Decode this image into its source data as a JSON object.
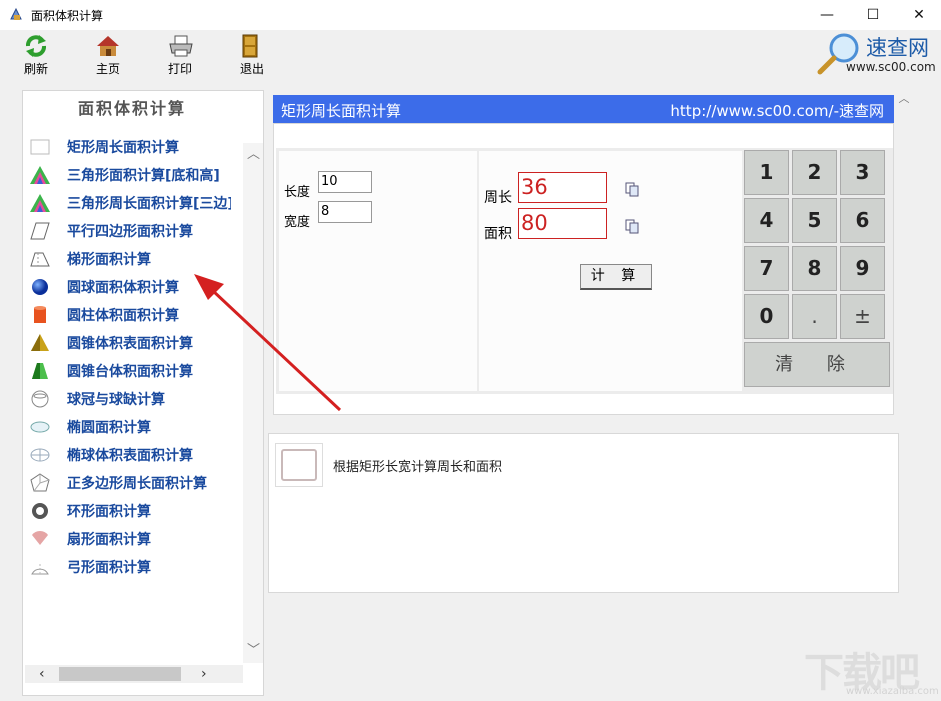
{
  "window": {
    "title": "面积体积计算",
    "controls": {
      "minimize": "—",
      "maximize": "☐",
      "close": "✕"
    }
  },
  "toolbar": {
    "refresh_label": "刷新",
    "home_label": "主页",
    "print_label": "打印",
    "exit_label": "退出"
  },
  "logo": {
    "name": "速查网",
    "url": "www.sc00.com"
  },
  "sidebar": {
    "title": "面积体积计算",
    "items": [
      {
        "label": "矩形周长面积计算",
        "icon": "rectangle-icon"
      },
      {
        "label": "三角形面积计算[底和高]",
        "icon": "triangle-icon"
      },
      {
        "label": "三角形周长面积计算[三边]",
        "icon": "triangle-icon"
      },
      {
        "label": "平行四边形面积计算",
        "icon": "parallelogram-icon"
      },
      {
        "label": "梯形面积计算",
        "icon": "trapezoid-icon"
      },
      {
        "label": "圆球面积体积计算",
        "icon": "sphere-icon"
      },
      {
        "label": "圆柱体积面积计算",
        "icon": "cylinder-icon"
      },
      {
        "label": "圆锥体积表面积计算",
        "icon": "cone-icon"
      },
      {
        "label": "圆锥台体积面积计算",
        "icon": "frustum-icon"
      },
      {
        "label": "球冠与球缺计算",
        "icon": "spherical-cap-icon"
      },
      {
        "label": "椭圆面积计算",
        "icon": "ellipse-icon"
      },
      {
        "label": "椭球体积表面积计算",
        "icon": "ellipsoid-icon"
      },
      {
        "label": "正多边形周长面积计算",
        "icon": "polygon-icon"
      },
      {
        "label": "环形面积计算",
        "icon": "ring-icon"
      },
      {
        "label": "扇形面积计算",
        "icon": "sector-icon"
      },
      {
        "label": "弓形面积计算",
        "icon": "segment-icon"
      }
    ]
  },
  "calculator": {
    "header_title": "矩形周长面积计算",
    "header_url": "http://www.sc00.com/-速查网",
    "length_label": "长度",
    "length_value": "10",
    "width_label": "宽度",
    "width_value": "8",
    "perimeter_label": "周长",
    "perimeter_value": "36",
    "area_label": "面积",
    "area_value": "80",
    "calc_button": "计 算",
    "keys": [
      "1",
      "2",
      "3",
      "4",
      "5",
      "6",
      "7",
      "8",
      "9",
      "0",
      ".",
      "±"
    ],
    "clear_button": "清 除"
  },
  "description": {
    "text": "根据矩形长宽计算周长和面积"
  },
  "watermark": {
    "text": "下载吧",
    "url": "www.xiazaiba.com"
  },
  "colors": {
    "header_blue": "#3c6ce9",
    "link_blue": "#1a4a9e",
    "result_red": "#cc2222",
    "arrow_red": "#d42020"
  }
}
